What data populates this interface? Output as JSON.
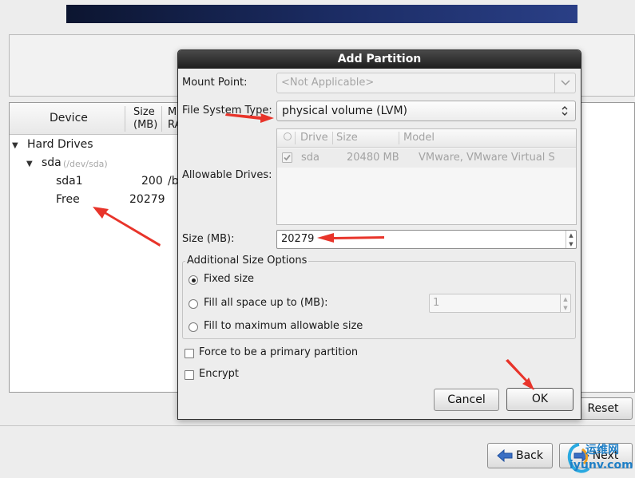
{
  "tree": {
    "columns": {
      "device": "Device",
      "size_line1": "Size",
      "size_line2": "(MB)",
      "mount_line1": "M",
      "mount_line2": "RA"
    },
    "hard_drives": "Hard Drives",
    "drive_name": "sda",
    "drive_path": "(/dev/sda)",
    "rows": [
      {
        "device": "sda1",
        "size": "200",
        "mount": "/b"
      },
      {
        "device": "Free",
        "size": "20279",
        "mount": ""
      }
    ]
  },
  "buttons": {
    "reset": "Reset",
    "back": "Back",
    "next": "Next"
  },
  "dialog": {
    "title": "Add Partition",
    "mount_point_label": "Mount Point:",
    "mount_point_value": "<Not Applicable>",
    "fs_type_label": "File System Type:",
    "fs_type_value": "physical volume (LVM)",
    "allowable_drives_label": "Allowable Drives:",
    "drives_columns": {
      "drive": "Drive",
      "size": "Size",
      "model": "Model"
    },
    "drives": [
      {
        "checked": true,
        "drive": "sda",
        "size": "20480 MB",
        "model": "VMware, VMware Virtual S"
      }
    ],
    "size_label": "Size (MB):",
    "size_value": "20279",
    "size_options_title": "Additional Size Options",
    "options": {
      "fixed": "Fixed size",
      "fill_upto": "Fill all space up to (MB):",
      "fill_max": "Fill to maximum allowable size"
    },
    "selected_option": "fixed",
    "fill_upto_value": "1",
    "force_primary_label": "Force to be a primary partition",
    "encrypt_label": "Encrypt",
    "cancel_label": "Cancel",
    "ok_label": "OK"
  },
  "watermark": {
    "line1": "运维网",
    "line2": "iyunv.com"
  },
  "colors": {
    "annotation_arrow": "#e8342a",
    "title_bar": "#2a2a2a",
    "banner": "#1c2d66"
  }
}
